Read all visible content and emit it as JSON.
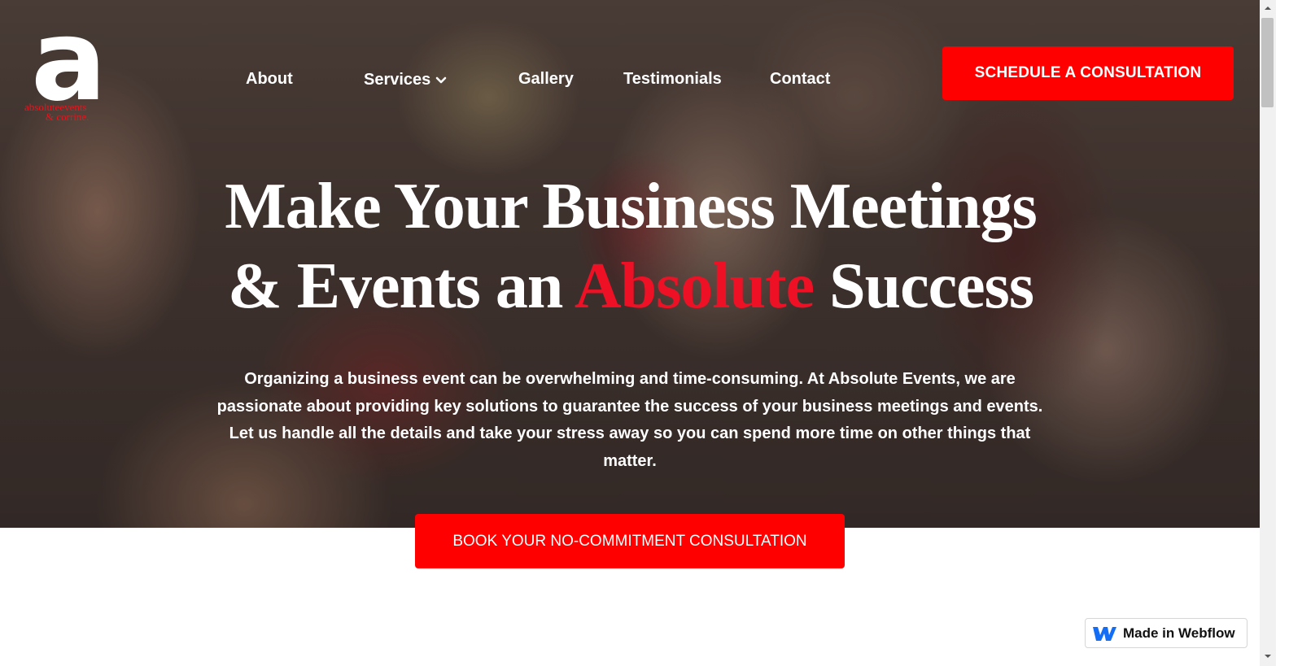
{
  "logo": {
    "mark": "a",
    "line1": "absoluteevents",
    "line2": "& corrine."
  },
  "nav": {
    "items": [
      {
        "label": "About"
      },
      {
        "label": "Services"
      },
      {
        "label": "Gallery"
      },
      {
        "label": "Testimonials"
      },
      {
        "label": "Contact"
      }
    ],
    "cta_label": "SCHEDULE A CONSULTATION"
  },
  "hero": {
    "headline_line1": "Make Your Business Meetings",
    "headline_line2_pre": "& Events an ",
    "headline_accent": "Absolute",
    "headline_line2_post": " Success",
    "intro": "Organizing a business event can be overwhelming and time-consuming. At Absolute Events, we are passionate about providing key solutions to guarantee the success of your business meetings and events. Let us handle all the details and take your stress away so you can spend more time on other things that matter.",
    "cta_label": "BOOK YOUR NO-COMMITMENT CONSULTATION"
  },
  "badge": {
    "label": "Made in Webflow",
    "icon": "webflow-icon"
  },
  "colors": {
    "accent": "#ff0000",
    "headline_accent": "#ee1126"
  }
}
